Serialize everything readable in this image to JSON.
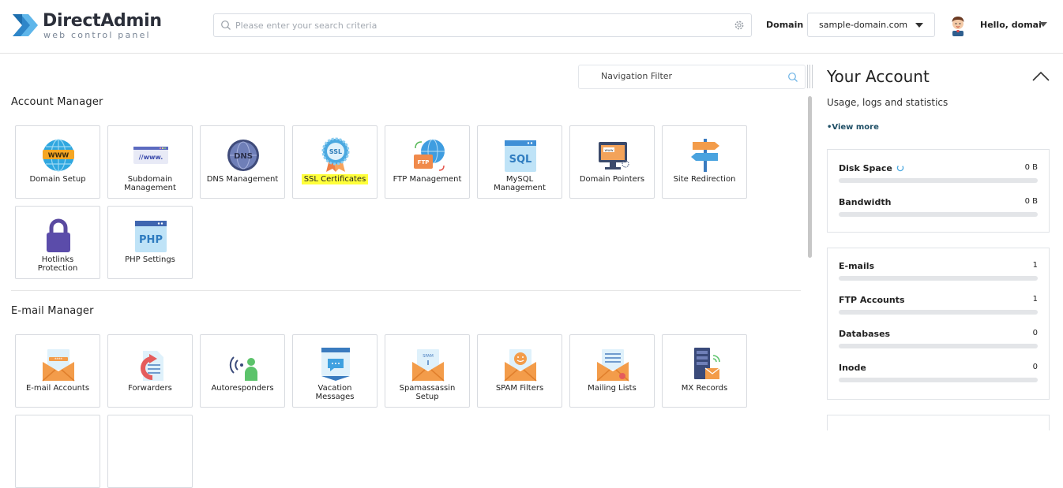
{
  "header": {
    "logo_title": "DirectAdmin",
    "logo_subtitle": "web control panel",
    "search_placeholder": "Please enter your search criteria",
    "domain_label": "Domain",
    "domain_value": "sample-domain.com",
    "greeting": "Hello, domai"
  },
  "main": {
    "nav_filter_placeholder": "Navigation Filter",
    "account_manager": {
      "title": "Account Manager",
      "items": [
        {
          "label": "Domain Setup",
          "icon": "www-globe-icon"
        },
        {
          "label": "Subdomain Management",
          "icon": "subdomain-icon"
        },
        {
          "label": "DNS Management",
          "icon": "dns-globe-icon"
        },
        {
          "label": "SSL Certificates",
          "icon": "ssl-badge-icon",
          "highlighted": true
        },
        {
          "label": "FTP Management",
          "icon": "ftp-globe-icon"
        },
        {
          "label": "MySQL Management",
          "icon": "sql-window-icon"
        },
        {
          "label": "Domain Pointers",
          "icon": "domain-pointer-icon"
        },
        {
          "label": "Site Redirection",
          "icon": "signpost-icon"
        },
        {
          "label": "Hotlinks Protection",
          "icon": "padlock-icon"
        },
        {
          "label": "PHP Settings",
          "icon": "php-window-icon"
        }
      ]
    },
    "email_manager": {
      "title": "E-mail Manager",
      "items": [
        {
          "label": "E-mail Accounts",
          "icon": "email-accounts-icon"
        },
        {
          "label": "Forwarders",
          "icon": "forward-arrow-icon"
        },
        {
          "label": "Autoresponders",
          "icon": "autoresponder-icon"
        },
        {
          "label": "Vacation Messages",
          "icon": "vacation-message-icon"
        },
        {
          "label": "Spamassassin Setup",
          "icon": "spam-envelope-icon"
        },
        {
          "label": "SPAM Filters",
          "icon": "spam-filter-icon"
        },
        {
          "label": "Mailing Lists",
          "icon": "mailing-list-icon"
        },
        {
          "label": "MX Records",
          "icon": "mx-records-icon"
        }
      ]
    }
  },
  "account": {
    "title": "Your Account",
    "subtitle": "Usage, logs and statistics",
    "view_more": "•View more",
    "usage": [
      {
        "label": "Disk Space",
        "value": "0 B",
        "loading": true
      },
      {
        "label": "Bandwidth",
        "value": "0 B"
      }
    ],
    "counts": [
      {
        "label": "E-mails",
        "value": "1"
      },
      {
        "label": "FTP Accounts",
        "value": "1"
      },
      {
        "label": "Databases",
        "value": "0"
      },
      {
        "label": "Inode",
        "value": "0"
      }
    ]
  },
  "colors": {
    "accent_blue": "#2f8fdb",
    "highlight_yellow": "#ffff3a",
    "bar_track": "#e3e5e8"
  }
}
